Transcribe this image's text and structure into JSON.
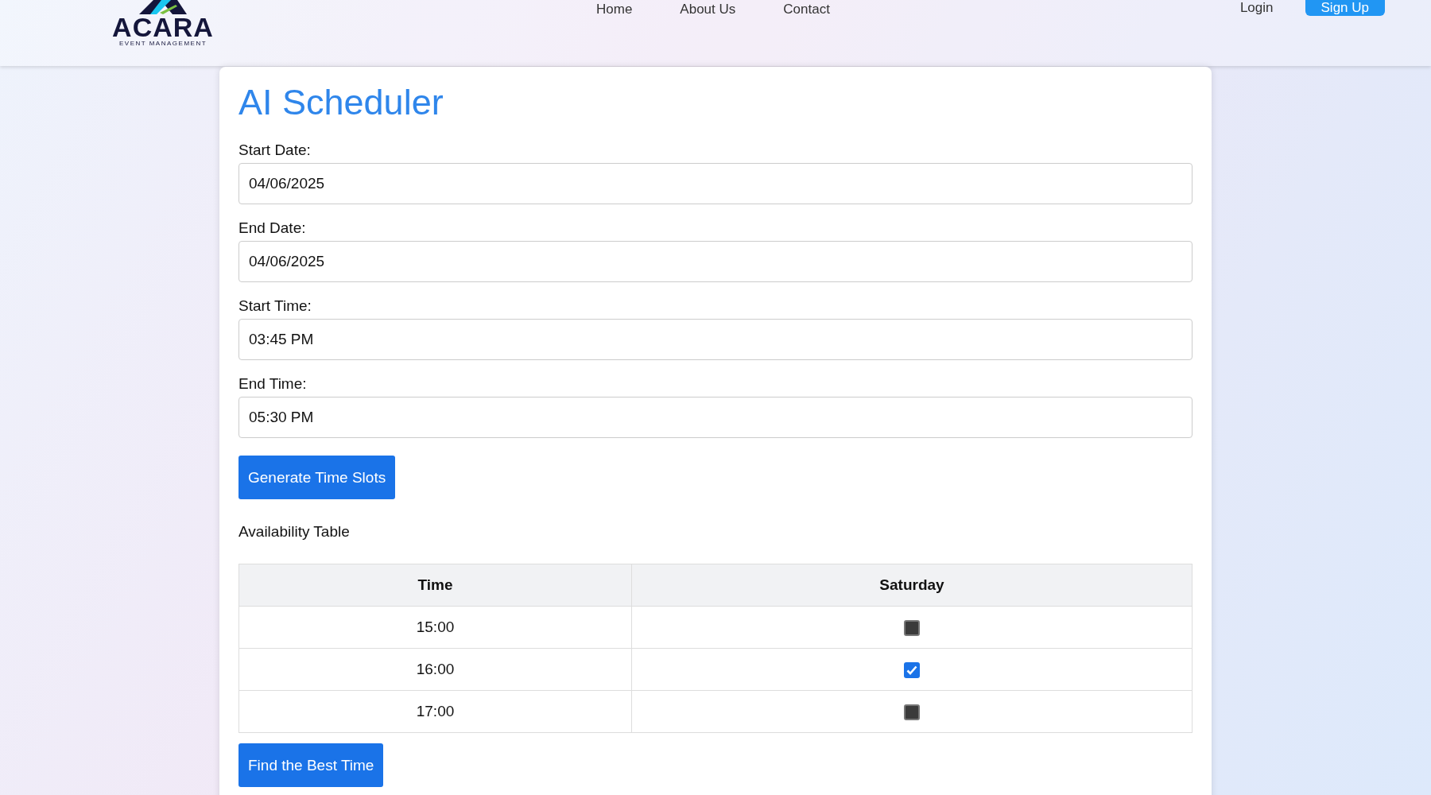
{
  "header": {
    "logo": {
      "name": "ACARA",
      "tagline": "EVENT MANAGEMENT"
    },
    "nav": [
      "Home",
      "About Us",
      "Contact"
    ],
    "login": "Login",
    "signup": "Sign Up"
  },
  "title": "AI Scheduler",
  "fields": [
    {
      "label": "Start Date:",
      "value": "04/06/2025"
    },
    {
      "label": "End Date:",
      "value": "04/06/2025"
    },
    {
      "label": "Start Time:",
      "value": "03:45 PM"
    },
    {
      "label": "End Time:",
      "value": "05:30 PM"
    }
  ],
  "generate_button": "Generate Time Slots",
  "table_title": "Availability Table",
  "table": {
    "columns": [
      "Time",
      "Saturday"
    ],
    "rows": [
      {
        "time": "15:00",
        "checked": false
      },
      {
        "time": "16:00",
        "checked": true
      },
      {
        "time": "17:00",
        "checked": false
      }
    ]
  },
  "find_button": "Find the Best Time"
}
